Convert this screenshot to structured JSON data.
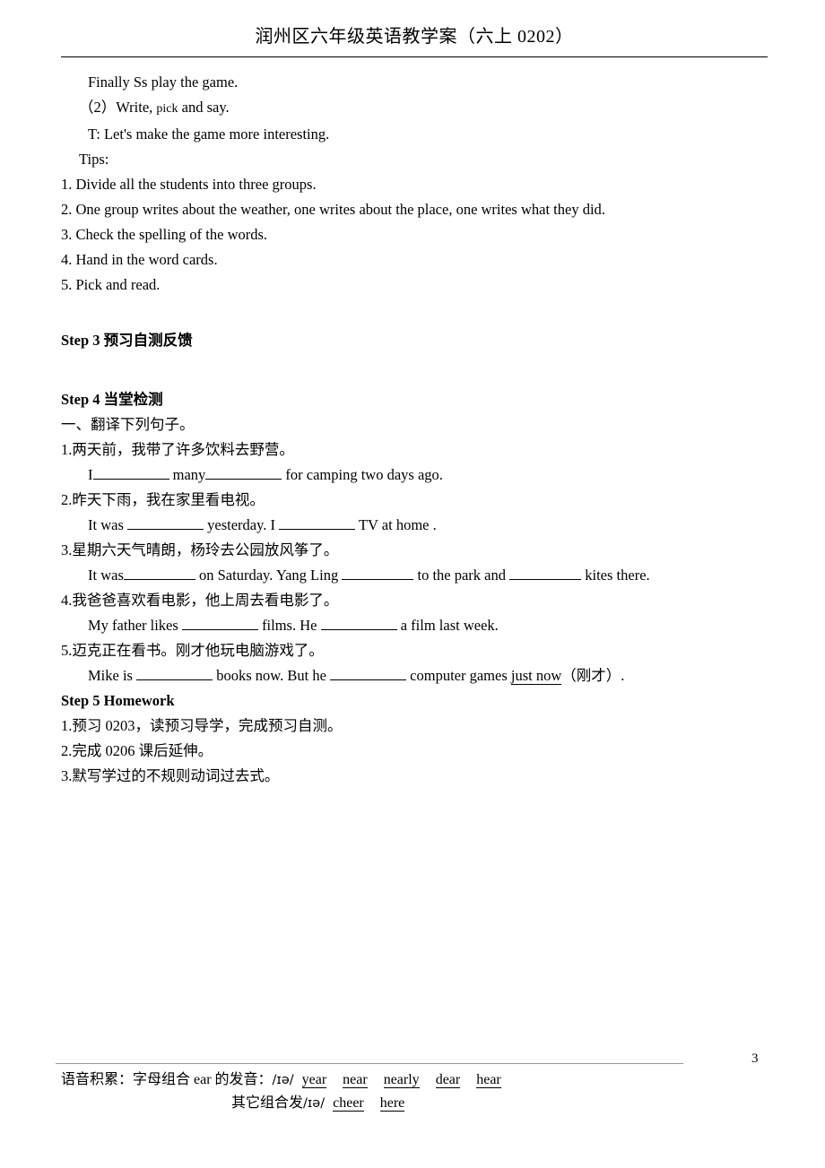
{
  "header": {
    "title": "润州区六年级英语教学案（六上 0202）"
  },
  "body": {
    "line_finally": "Finally Ss play the game.",
    "line_write_pick_prefix": "（2）Write,",
    "line_write_pick_small": "pick",
    "line_write_pick_suffix": "and say.",
    "line_teacher": "T: Let's make the game more interesting.",
    "tips_label": "Tips:",
    "tips": [
      "1. Divide all the students into three groups.",
      "2. One group writes about the weather, one writes about the place, one writes what they did.",
      "3. Check the spelling of the words.",
      "4. Hand in the word cards.",
      "5. Pick and read."
    ],
    "step3_heading": "Step 3 预习自测反馈",
    "step4_heading": "Step 4 当堂检测",
    "section_one": "一、翻译下列句子。",
    "exercises": [
      {
        "cn": "1.两天前，我带了许多饮料去野营。",
        "en_parts": [
          "I",
          "many",
          "for camping two days ago."
        ]
      },
      {
        "cn": "2.昨天下雨，我在家里看电视。",
        "en_parts": [
          "It was ",
          " yesterday. I ",
          " TV at home ."
        ]
      },
      {
        "cn": "3.星期六天气晴朗，杨玲去公园放风筝了。",
        "en_parts": [
          "It was",
          " on Saturday. Yang Ling ",
          " to the park and ",
          " kites there."
        ]
      },
      {
        "cn": "4.我爸爸喜欢看电影，他上周去看电影了。",
        "en_parts": [
          "My father likes ",
          " films. He ",
          " a film last week."
        ]
      },
      {
        "cn": "5.迈克正在看书。刚才他玩电脑游戏了。",
        "en_parts": [
          "Mike is ",
          " books now. But he ",
          " computer games ",
          "just now",
          "（刚才）."
        ]
      }
    ],
    "step5_heading": "Step 5 Homework",
    "homework": [
      "1.预习 0203，读预习导学，完成预习自测。",
      "2.完成 0206 课后延伸。",
      "3.默写学过的不规则动词过去式。"
    ]
  },
  "footer": {
    "page_number": "3",
    "line1_label": "语音积累：字母组合 ear 的发音：",
    "line1_phonetic": "/ɪə/",
    "line1_words": [
      "year",
      "near",
      "nearly",
      "dear",
      "hear"
    ],
    "line2_label": "其它组合发",
    "line2_phonetic": "/ɪə/",
    "line2_words": [
      "cheer",
      "here"
    ]
  }
}
